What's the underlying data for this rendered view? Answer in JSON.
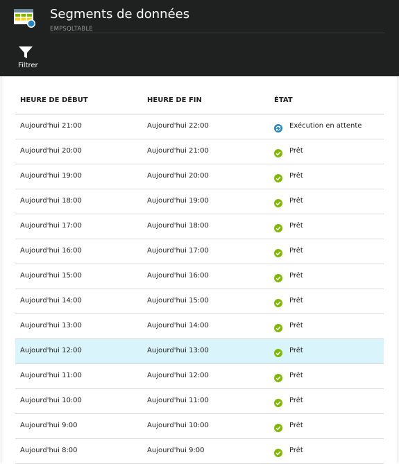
{
  "header": {
    "title": "Segments de données",
    "subtitle": "EMPSQLTABLE"
  },
  "toolbar": {
    "filter_label": "Filtrer"
  },
  "table": {
    "columns": [
      "HEURE DE DÉBUT",
      "HEURE DE FIN",
      "ÉTAT"
    ],
    "rows": [
      {
        "start": "Aujourd'hui 21:00",
        "end": "Aujourd'hui 22:00",
        "status": "Exécution en attente",
        "status_icon": "refresh-pending-icon"
      },
      {
        "start": "Aujourd'hui 20:00",
        "end": "Aujourd'hui 21:00",
        "status": "Prêt",
        "status_icon": "check-icon"
      },
      {
        "start": "Aujourd'hui 19:00",
        "end": "Aujourd'hui 20:00",
        "status": "Prêt",
        "status_icon": "check-icon"
      },
      {
        "start": "Aujourd'hui 18:00",
        "end": "Aujourd'hui 19:00",
        "status": "Prêt",
        "status_icon": "check-icon"
      },
      {
        "start": "Aujourd'hui 17:00",
        "end": "Aujourd'hui 18:00",
        "status": "Prêt",
        "status_icon": "check-icon"
      },
      {
        "start": "Aujourd'hui 16:00",
        "end": "Aujourd'hui 17:00",
        "status": "Prêt",
        "status_icon": "check-icon"
      },
      {
        "start": "Aujourd'hui 15:00",
        "end": "Aujourd'hui 16:00",
        "status": "Prêt",
        "status_icon": "check-icon"
      },
      {
        "start": "Aujourd'hui 14:00",
        "end": "Aujourd'hui 15:00",
        "status": "Prêt",
        "status_icon": "check-icon"
      },
      {
        "start": "Aujourd'hui 13:00",
        "end": "Aujourd'hui 14:00",
        "status": "Prêt",
        "status_icon": "check-icon"
      },
      {
        "start": "Aujourd'hui 12:00",
        "end": "Aujourd'hui 13:00",
        "status": "Prêt",
        "status_icon": "check-icon",
        "selected": true
      },
      {
        "start": "Aujourd'hui 11:00",
        "end": "Aujourd'hui 12:00",
        "status": "Prêt",
        "status_icon": "check-icon"
      },
      {
        "start": "Aujourd'hui 10:00",
        "end": "Aujourd'hui 11:00",
        "status": "Prêt",
        "status_icon": "check-icon"
      },
      {
        "start": "Aujourd'hui 9:00",
        "end": "Aujourd'hui 10:00",
        "status": "Prêt",
        "status_icon": "check-icon"
      },
      {
        "start": "Aujourd'hui 8:00",
        "end": "Aujourd'hui 9:00",
        "status": "Prêt",
        "status_icon": "check-icon"
      }
    ]
  },
  "colors": {
    "header_bg": "#1f2020",
    "ready_green": "#7fba00",
    "pending_blue": "#1f85c7",
    "selected_row": "#d9f4fb"
  }
}
